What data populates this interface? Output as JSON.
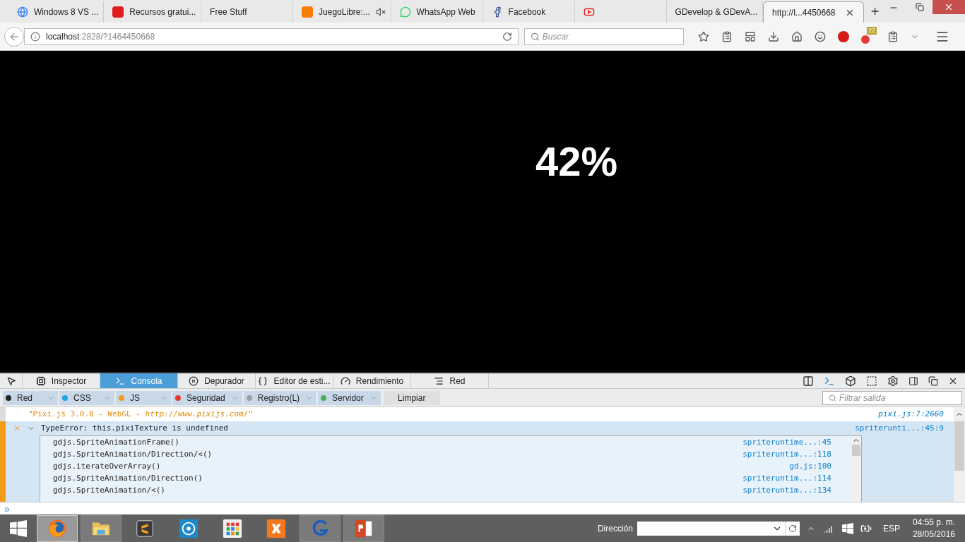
{
  "browser_tabs": [
    {
      "label": "Windows 8 VS ...",
      "selected": false,
      "muted": false
    },
    {
      "label": "Recursos gratui...",
      "selected": false,
      "muted": false
    },
    {
      "label": "Free Stuff",
      "selected": false,
      "muted": false
    },
    {
      "label": "JuegoLibre:...",
      "selected": false,
      "muted": true
    },
    {
      "label": "WhatsApp Web",
      "selected": false,
      "muted": false
    },
    {
      "label": "Facebook",
      "selected": false,
      "muted": false
    },
    {
      "selected": false,
      "muted": false
    },
    {
      "label": "GDevelop & GDevA...",
      "selected": false,
      "muted": false
    },
    {
      "label": "http://l...4450668",
      "selected": true,
      "muted": false
    }
  ],
  "address": {
    "host": "localhost",
    "path": ":2828/?1464450668"
  },
  "search": {
    "placeholder": "Buscar"
  },
  "addon_badge": "22",
  "page": {
    "loading_text": "42%"
  },
  "devtools": {
    "tabs": [
      {
        "label": "Inspector",
        "selected": false
      },
      {
        "label": "Consola",
        "selected": true
      },
      {
        "label": "Depurador",
        "selected": false
      },
      {
        "label": "Editor de esti...",
        "selected": false
      },
      {
        "label": "Rendimiento",
        "selected": false
      },
      {
        "label": "Red",
        "selected": false
      }
    ],
    "filters": [
      {
        "label": "Red",
        "color": "#222222"
      },
      {
        "label": "CSS",
        "color": "#1ba6e0"
      },
      {
        "label": "JS",
        "color": "#f29b17"
      },
      {
        "label": "Seguridad",
        "color": "#e53935"
      },
      {
        "label": "Registro(L)",
        "color": "#9e9e9e"
      },
      {
        "label": "Servidor",
        "color": "#4caf50"
      }
    ],
    "clear_button": "Limpiar",
    "filter_field": {
      "placeholder": "Filtrar salida"
    },
    "messages": [
      {
        "kind": "log",
        "text": "\"Pixi.js 3.0.8 - WebGL - *http://www.pixijs.com/*\"",
        "source": "pixi.js:7:2660"
      },
      {
        "kind": "error",
        "text": "TypeError: this.pixiTexture is undefined",
        "source": "spriterunti...:45:9",
        "expanded": true,
        "stack": [
          {
            "function": "gdjs.SpriteAnimationFrame()",
            "source": "spriteruntime...:45"
          },
          {
            "function": "gdjs.SpriteAnimation/Direction/<()",
            "source": "spriteruntim...:118"
          },
          {
            "function": "gdjs.iterateOverArray()",
            "source": "gd.js:100"
          },
          {
            "function": "gdjs.SpriteAnimation/Direction()",
            "source": "spriteruntim...:114"
          },
          {
            "function": "gdjs.SpriteAnimation/<()",
            "source": "spriteruntim...:134"
          }
        ]
      }
    ],
    "prompt": "»"
  },
  "taskbar": {
    "apps": [
      {
        "selected": true
      },
      {
        "selected": false
      },
      {
        "selected": false
      },
      {
        "selected": false
      },
      {
        "selected": false
      },
      {
        "selected": false
      },
      {
        "selected": false
      },
      {
        "selected": false
      }
    ],
    "address_label": "Dirección",
    "language": "ESP",
    "time": "04:55 p. m.",
    "date": "28/05/2016"
  }
}
